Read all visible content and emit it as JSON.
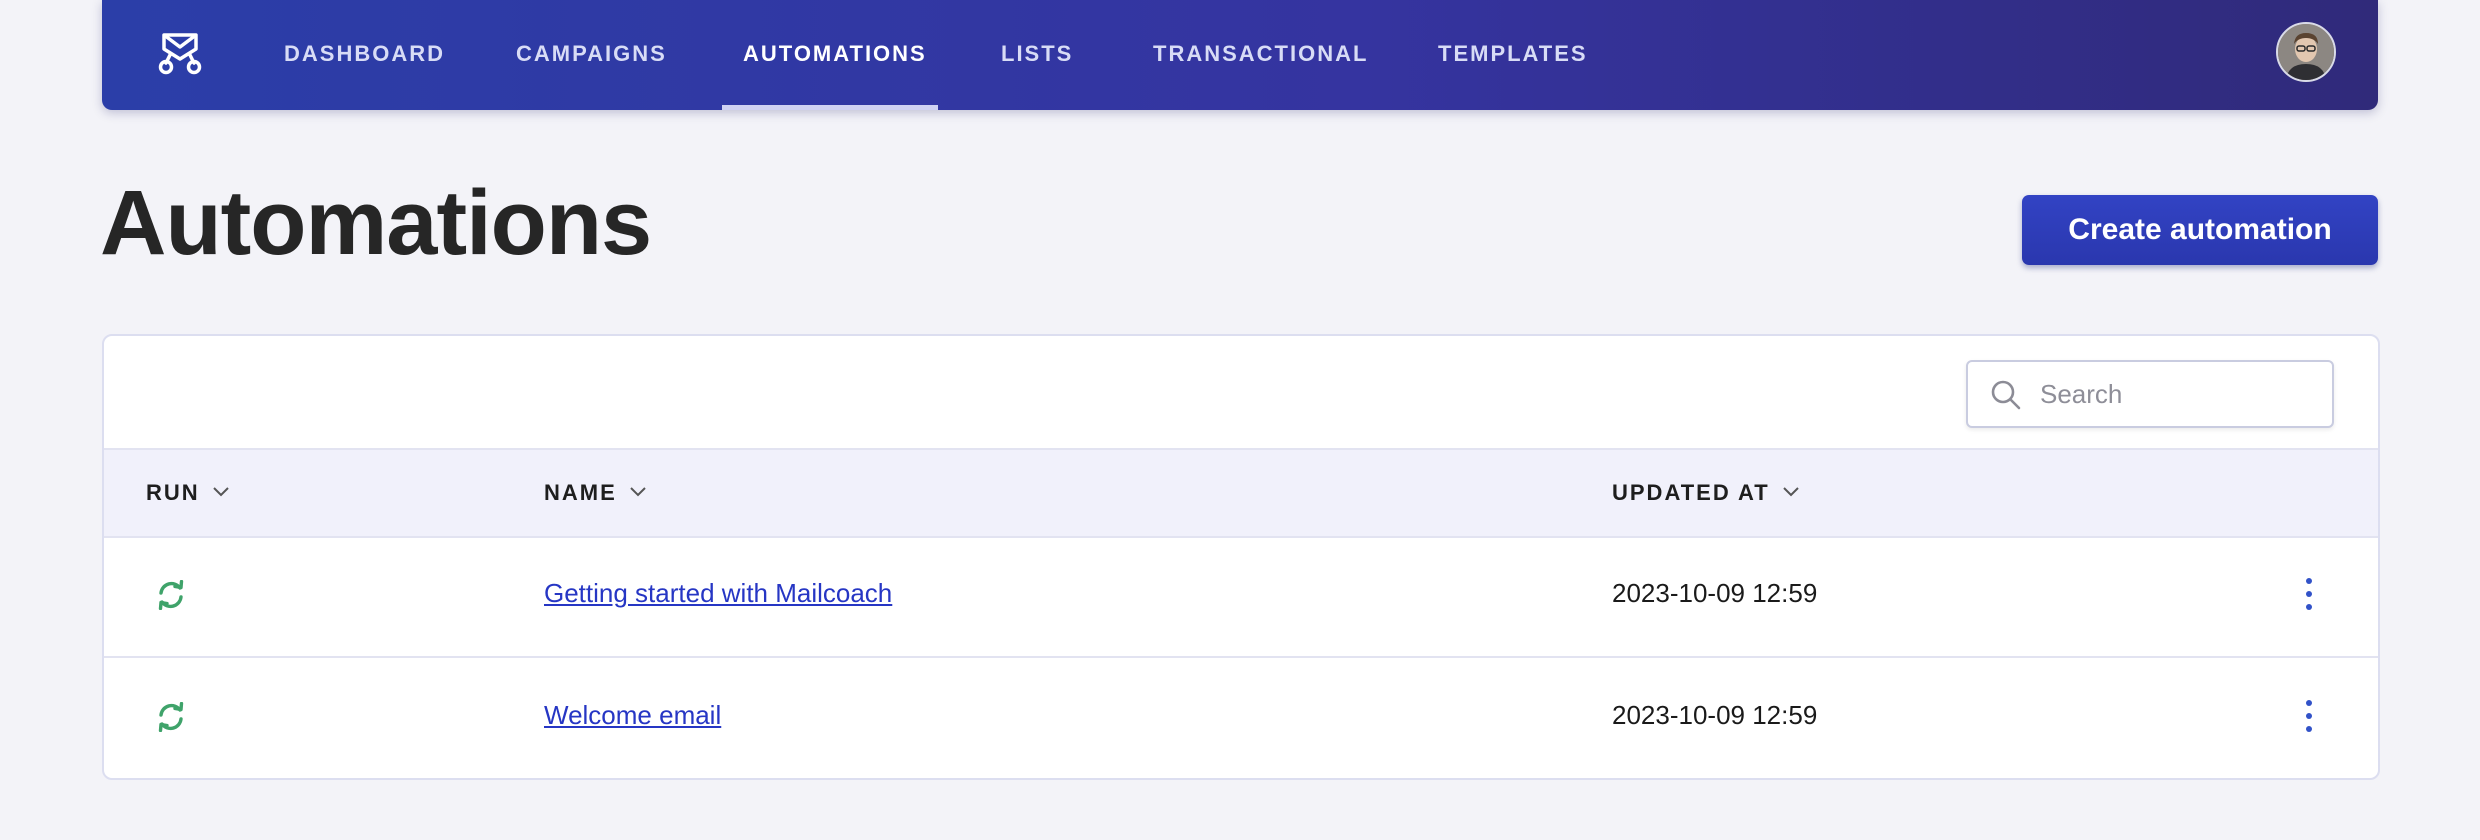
{
  "nav": {
    "items": [
      {
        "label": "DASHBOARD",
        "active": false
      },
      {
        "label": "CAMPAIGNS",
        "active": false
      },
      {
        "label": "AUTOMATIONS",
        "active": true
      },
      {
        "label": "LISTS",
        "active": false
      },
      {
        "label": "TRANSACTIONAL",
        "active": false
      },
      {
        "label": "TEMPLATES",
        "active": false
      }
    ],
    "logo_icon": "mailcoach-logo-icon",
    "avatar_icon": "user-avatar"
  },
  "page": {
    "title": "Automations",
    "create_button": "Create automation"
  },
  "search": {
    "placeholder": "Search",
    "value": ""
  },
  "table": {
    "columns": [
      {
        "label": "RUN",
        "sortable": true
      },
      {
        "label": "NAME",
        "sortable": true
      },
      {
        "label": "UPDATED AT",
        "sortable": true
      }
    ],
    "rows": [
      {
        "run_status_icon": "refresh-icon",
        "name": "Getting started with Mailcoach",
        "updated_at": "2023-10-09 12:59"
      },
      {
        "run_status_icon": "refresh-icon",
        "name": "Welcome email",
        "updated_at": "2023-10-09 12:59"
      }
    ]
  },
  "colors": {
    "accent": "#2b3ea8",
    "link": "#2636c4",
    "run_icon": "#3fa36a",
    "kebab": "#3152c8"
  }
}
